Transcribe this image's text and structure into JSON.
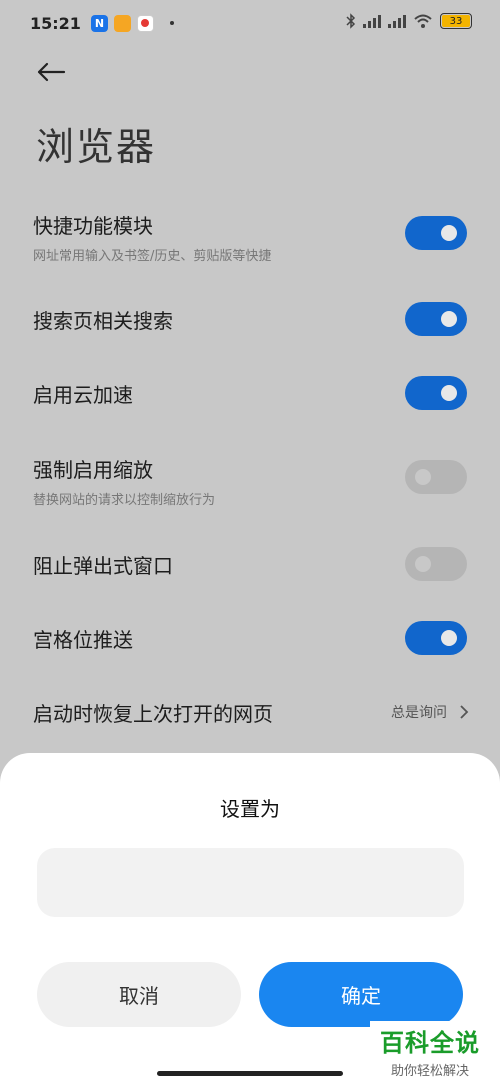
{
  "status_bar": {
    "time": "15:21",
    "app_icons": [
      {
        "name": "n-app-icon",
        "glyph": "N",
        "color": "#1a73e8"
      },
      {
        "name": "notes-app-icon",
        "glyph": "■",
        "color": "#f5a623"
      },
      {
        "name": "red-app-icon",
        "glyph": "●",
        "color": "#e53935"
      }
    ],
    "battery": "33"
  },
  "header": {
    "back_icon": "arrow-left-icon",
    "title": "浏览器"
  },
  "settings": [
    {
      "title": "快捷功能模块",
      "subtitle": "网址常用输入及书签/历史、剪贴版等快捷",
      "toggle": true
    },
    {
      "title": "搜索页相关搜索",
      "subtitle": "",
      "toggle": true
    },
    {
      "title": "启用云加速",
      "subtitle": "",
      "toggle": true
    },
    {
      "title": "强制启用缩放",
      "subtitle": "替换网站的请求以控制缩放行为",
      "toggle": false
    },
    {
      "title": "阻止弹出式窗口",
      "subtitle": "",
      "toggle": false
    },
    {
      "title": "宫格位推送",
      "subtitle": "",
      "toggle": true
    },
    {
      "title": "启动时恢复上次打开的网页",
      "value": "总是询问"
    }
  ],
  "dialog": {
    "title": "设置为",
    "input_value": "",
    "cancel_label": "取消",
    "ok_label": "确定"
  },
  "watermark": {
    "main": "百科全说",
    "sub": "助你轻松解决"
  },
  "colors": {
    "toggle_on": "#1166cc",
    "toggle_off": "#b5b5b5",
    "primary_button": "#1a86f0",
    "watermark_green": "#1a9c2a"
  }
}
